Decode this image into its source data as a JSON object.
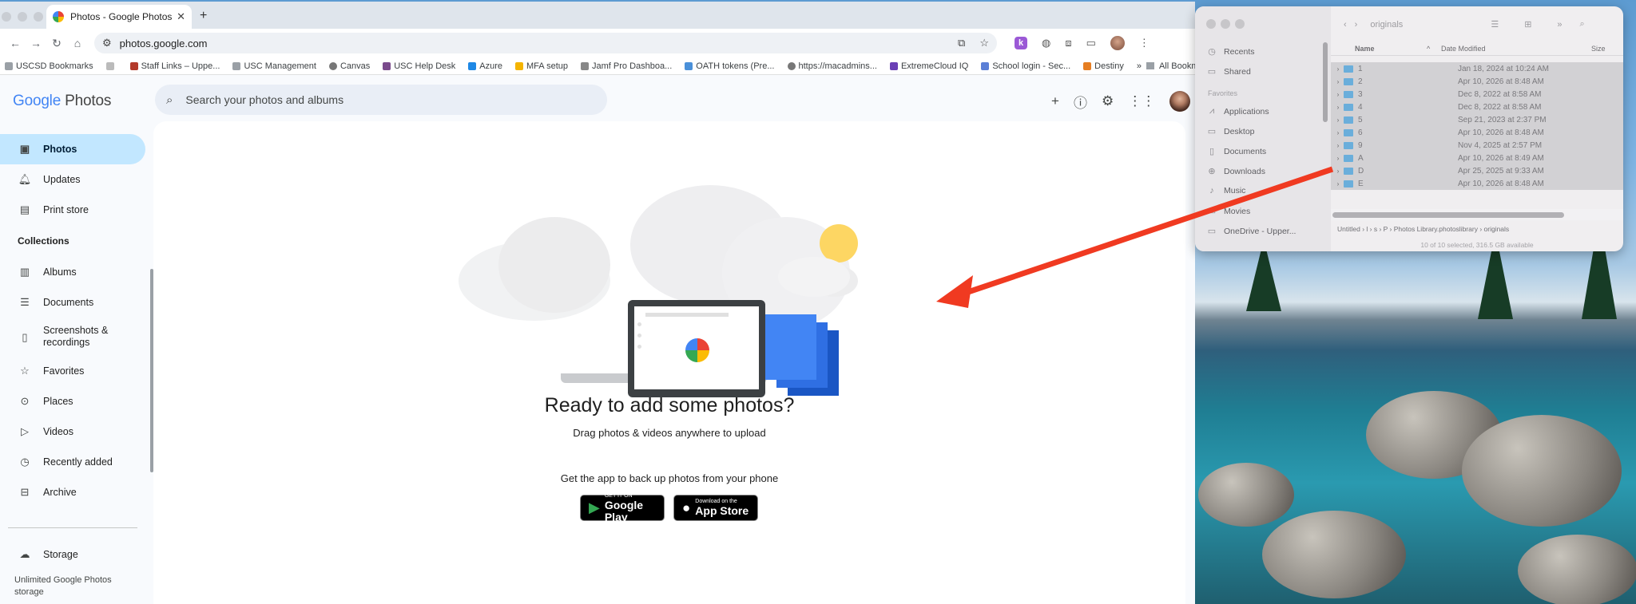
{
  "browser": {
    "tab_title": "Photos - Google Photos",
    "url": "photos.google.com",
    "bookmarks": [
      "USCSD Bookmarks",
      "Staff Links – Uppe...",
      "USC Management",
      "Canvas",
      "USC Help Desk",
      "Azure",
      "MFA setup",
      "Jamf Pro Dashboa...",
      "OATH tokens (Pre...",
      "https://macadmins...",
      "ExtremeCloud IQ",
      "School login - Sec...",
      "Destiny"
    ],
    "all_bookmarks": "All Bookmarks",
    "profile_badge": "k"
  },
  "photos": {
    "logo_google": "Google",
    "logo_photos": "Photos",
    "search_placeholder": "Search your photos and albums",
    "nav": {
      "photos": "Photos",
      "updates": "Updates",
      "print_store": "Print store",
      "collections": "Collections",
      "albums": "Albums",
      "documents": "Documents",
      "screenshots": "Screenshots & recordings",
      "favorites": "Favorites",
      "places": "Places",
      "videos": "Videos",
      "recently_added": "Recently added",
      "archive": "Archive",
      "storage": "Storage",
      "storage_note": "Unlimited Google Photos storage"
    },
    "empty": {
      "title": "Ready to add some photos?",
      "subtitle": "Drag photos & videos anywhere to upload",
      "get_app": "Get the app to back up photos from your phone",
      "google_play_small": "GET IT ON",
      "google_play_big": "Google Play",
      "app_store_small": "Download on the",
      "app_store_big": "App Store"
    }
  },
  "finder": {
    "title": "originals",
    "sidebar": {
      "recents": "Recents",
      "shared": "Shared",
      "favorites_header": "Favorites",
      "applications": "Applications",
      "desktop": "Desktop",
      "documents": "Documents",
      "downloads": "Downloads",
      "music": "Music",
      "movies": "Movies",
      "onedrive": "OneDrive - Upper..."
    },
    "columns": {
      "name": "Name",
      "date": "Date Modified",
      "size": "Size"
    },
    "rows": [
      {
        "name": "1",
        "date": "Jan 18, 2024 at 10:24 AM"
      },
      {
        "name": "2",
        "date": "Apr 10, 2026 at 8:48 AM"
      },
      {
        "name": "3",
        "date": "Dec 8, 2022 at 8:58 AM"
      },
      {
        "name": "4",
        "date": "Dec 8, 2022 at 8:58 AM"
      },
      {
        "name": "5",
        "date": "Sep 21, 2023 at 2:37 PM"
      },
      {
        "name": "6",
        "date": "Apr 10, 2026 at 8:48 AM"
      },
      {
        "name": "9",
        "date": "Nov 4, 2025 at 2:57 PM"
      },
      {
        "name": "A",
        "date": "Apr 10, 2026 at 8:49 AM"
      },
      {
        "name": "D",
        "date": "Apr 25, 2025 at 9:33 AM"
      },
      {
        "name": "E",
        "date": "Apr 10, 2026 at 8:48 AM"
      }
    ],
    "path": [
      "Untitled",
      "l",
      "s",
      "P",
      "Photos Library.photoslibrary",
      "originals"
    ],
    "status": "10 of 10 selected, 316.5 GB available"
  },
  "colors": {
    "arrow": "#f03a21",
    "accent": "#c2e7ff"
  }
}
